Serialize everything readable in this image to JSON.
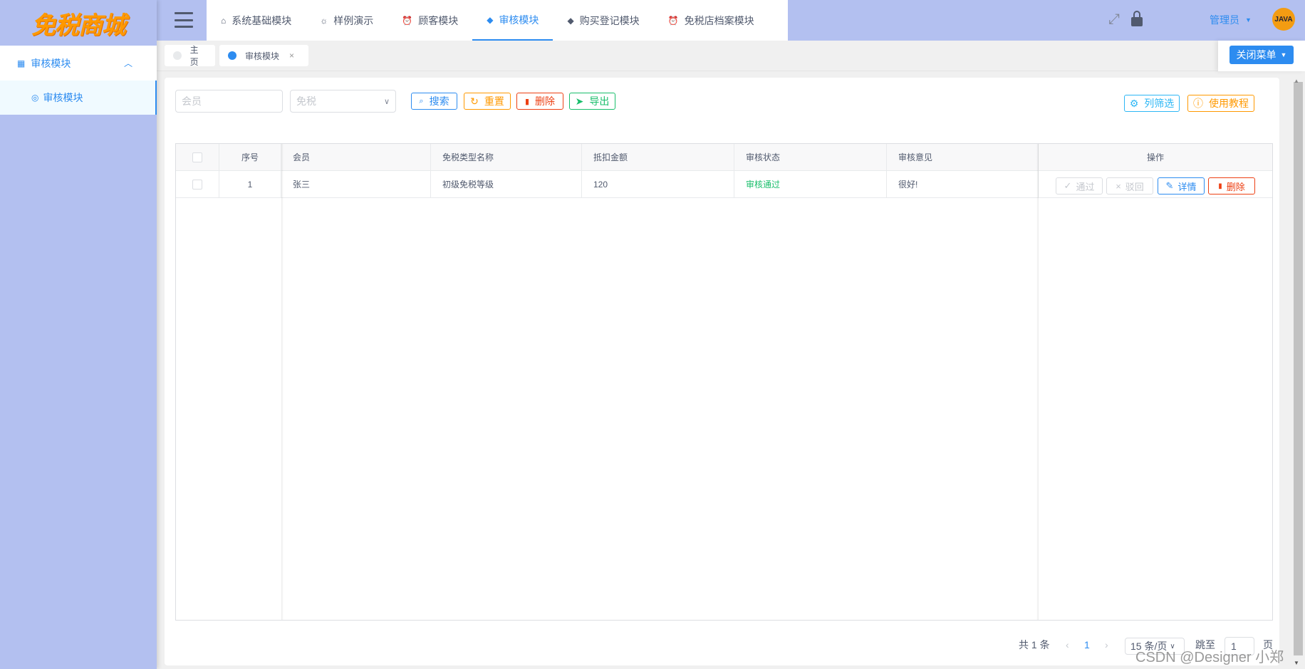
{
  "app": {
    "logo_text": "免税商城"
  },
  "sidebar": {
    "group_label": "审核模块",
    "items": [
      {
        "label": "审核模块"
      }
    ]
  },
  "nav": {
    "items": [
      {
        "label": "系统基础模块",
        "icon": "home-icon"
      },
      {
        "label": "样例演示",
        "icon": "bulb-icon"
      },
      {
        "label": "顾客模块",
        "icon": "alarm-icon"
      },
      {
        "label": "审核模块",
        "icon": "leaf-icon",
        "active": true
      },
      {
        "label": "购买登记模块",
        "icon": "leaf-icon"
      },
      {
        "label": "免税店档案模块",
        "icon": "alarm-icon"
      }
    ]
  },
  "header": {
    "user_name": "管理员",
    "avatar_text": "JAVA"
  },
  "tabs": [
    {
      "label": "主页"
    },
    {
      "label": "审核模块",
      "closable": true
    }
  ],
  "close_menu_label": "关闭菜单",
  "filters": {
    "member_placeholder": "会员",
    "type_placeholder": "免税"
  },
  "toolbar": {
    "search": "搜索",
    "reset": "重置",
    "delete": "删除",
    "export": "导出",
    "column_filter": "列筛选",
    "tutorial": "使用教程"
  },
  "table": {
    "headers": [
      "序号",
      "会员",
      "免税类型名称",
      "抵扣金额",
      "审核状态",
      "审核意见",
      "操作"
    ],
    "rows": [
      {
        "index": "1",
        "member": "张三",
        "type": "初级免税等级",
        "amount": "120",
        "status": "审核通过",
        "opinion": "很好!"
      }
    ],
    "actions": {
      "approve": "通过",
      "reject": "驳回",
      "detail": "详情",
      "delete": "删除"
    }
  },
  "pagination": {
    "total": "共 1 条",
    "current": "1",
    "page_size": "15 条/页",
    "jump_label": "跳至",
    "jump_value": "1",
    "page_suffix": "页"
  },
  "watermark": "CSDN @Designer 小郑",
  "colors": {
    "primary": "#2d8cf0",
    "sidebar": "#b3c0f0",
    "warning": "#ff9900",
    "error": "#ed4014",
    "success": "#19be6b",
    "info": "#2db7f5"
  }
}
